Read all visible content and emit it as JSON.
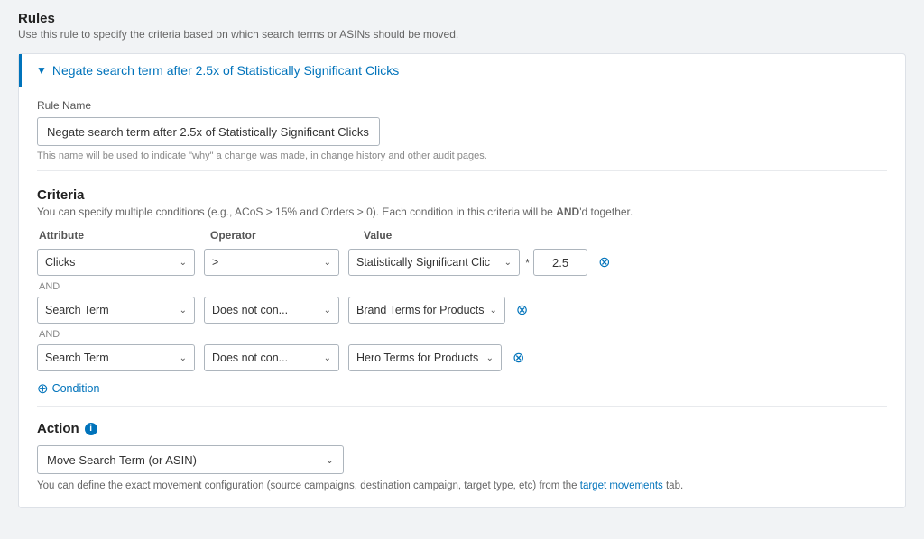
{
  "page": {
    "title": "Rules",
    "subtitle": "Use this rule to specify the criteria based on which search terms or ASINs should be moved."
  },
  "rule_card": {
    "header_chevron": "▼",
    "header_title": "Negate search term after 2.5x of Statistically Significant Clicks"
  },
  "rule_name": {
    "label": "Rule Name",
    "value": "Negate search term after 2.5x of Statistically Significant Clicks",
    "hint": "This name will be used to indicate \"why\" a change was made, in change history and other audit pages."
  },
  "criteria": {
    "title": "Criteria",
    "hint_prefix": "You can specify multiple conditions (e.g., ACoS > 15% and Orders > 0). Each condition in this criteria will be ",
    "hint_bold": "AND",
    "hint_suffix": "'d together.",
    "col_attribute": "Attribute",
    "col_operator": "Operator",
    "col_value": "Value",
    "rows": [
      {
        "id": "row1",
        "attribute": "Clicks",
        "operator": ">",
        "value": "Statistically Significant Clic",
        "multiplier": "*",
        "multiplier_value": "2.5",
        "and_label": "AND"
      },
      {
        "id": "row2",
        "attribute": "Search Term",
        "operator": "Does not con...",
        "value": "Brand Terms for Products",
        "and_label": "AND"
      },
      {
        "id": "row3",
        "attribute": "Search Term",
        "operator": "Does not con...",
        "value": "Hero Terms for Products"
      }
    ],
    "add_condition_label": "Condition"
  },
  "action": {
    "title": "Action",
    "select_value": "Move Search Term (or ASIN)",
    "hint_prefix": "You can define the exact movement configuration (source campaigns, destination campaign, target type, etc) from the ",
    "hint_link": "target movements",
    "hint_suffix": " tab."
  },
  "icons": {
    "delete": "⊗",
    "add_circle": "⊕",
    "info": "i",
    "chevron_down": "∨"
  }
}
